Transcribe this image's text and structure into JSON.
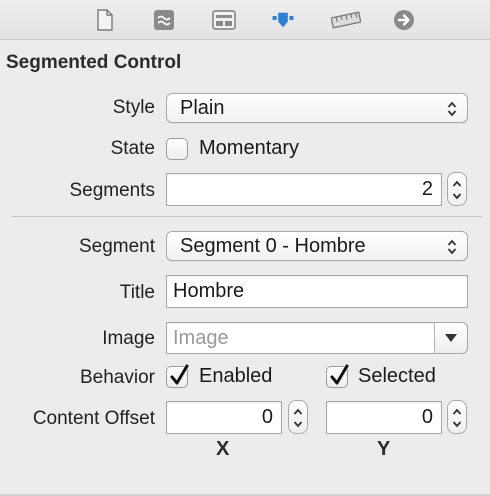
{
  "toolbar": {
    "tabs": [
      {
        "icon": "file-icon"
      },
      {
        "icon": "quick-help-icon"
      },
      {
        "icon": "identity-icon"
      },
      {
        "icon": "attributes-icon",
        "selected": true
      },
      {
        "icon": "size-ruler-icon"
      },
      {
        "icon": "connections-arrow-icon"
      }
    ],
    "accent": "#2f7fd6"
  },
  "section": {
    "title": "Segmented Control"
  },
  "style": {
    "label": "Style",
    "value": "Plain"
  },
  "state": {
    "label": "State",
    "option_label": "Momentary",
    "checked": false
  },
  "segments": {
    "label": "Segments",
    "value": "2"
  },
  "segment": {
    "label": "Segment",
    "value": "Segment 0 - Hombre"
  },
  "title_field": {
    "label": "Title",
    "value": "Hombre"
  },
  "image": {
    "label": "Image",
    "placeholder": "Image"
  },
  "behavior": {
    "label": "Behavior",
    "enabled_label": "Enabled",
    "enabled_checked": true,
    "selected_label": "Selected",
    "selected_checked": true
  },
  "content_offset": {
    "label": "Content Offset",
    "x_value": "0",
    "y_value": "0",
    "x_label": "X",
    "y_label": "Y"
  }
}
